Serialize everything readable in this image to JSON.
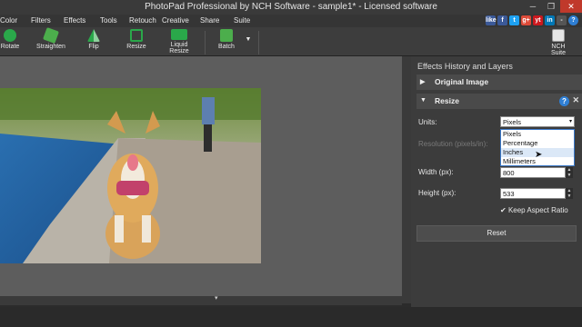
{
  "window": {
    "title": "PhotoPad Professional by NCH Software - sample1* - Licensed software"
  },
  "menu": [
    {
      "label": "Color"
    },
    {
      "label": "Filters"
    },
    {
      "label": "Effects"
    },
    {
      "label": "Tools"
    },
    {
      "label": "Retouch"
    },
    {
      "label": "Creative"
    },
    {
      "label": "Share"
    },
    {
      "label": "Suite"
    }
  ],
  "social": [
    "like",
    "f",
    "t",
    "g+",
    "yt",
    "in",
    "-",
    "?"
  ],
  "toolbar": [
    {
      "label": "Rotate",
      "icon": "rotate-icon"
    },
    {
      "label": "Straighten",
      "icon": "straighten-icon"
    },
    {
      "label": "Flip",
      "icon": "flip-icon"
    },
    {
      "label": "Resize",
      "icon": "resize-icon"
    },
    {
      "label": "Liquid Resize",
      "icon": "liquid-resize-icon"
    },
    {
      "label": "Batch",
      "icon": "batch-icon"
    },
    {
      "label": "NCH Suite",
      "icon": "nch-suite-icon"
    }
  ],
  "panel": {
    "title": "Effects History and Layers",
    "original": "Original Image",
    "resize": {
      "title": "Resize",
      "units_label": "Units:",
      "units_value": "Pixels",
      "options": [
        "Pixels",
        "Percentage",
        "Inches",
        "Millimeters"
      ],
      "resolution_label": "Resolution (pixels/in):",
      "width_label": "Width (px):",
      "width_value": "800",
      "height_label": "Height (px):",
      "height_value": "533",
      "keep_aspect": "Keep Aspect Ratio",
      "reset": "Reset"
    }
  },
  "colors": {
    "accent": "#2f7fd4",
    "panel": "#3c3c3c",
    "canvas": "#5d5d5d"
  }
}
